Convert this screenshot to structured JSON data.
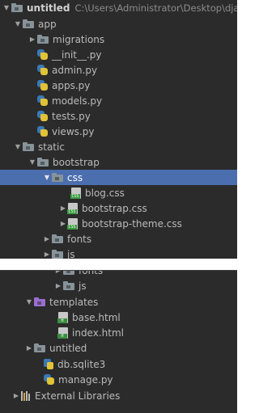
{
  "top_panel": {
    "rows": [
      {
        "label": "untitled",
        "path": "C:\\Users\\Administrator\\Desktop\\django"
      },
      {
        "label": "app"
      },
      {
        "label": "migrations"
      },
      {
        "label": "__init__.py"
      },
      {
        "label": "admin.py"
      },
      {
        "label": "apps.py"
      },
      {
        "label": "models.py"
      },
      {
        "label": "tests.py"
      },
      {
        "label": "views.py"
      },
      {
        "label": "static"
      },
      {
        "label": "bootstrap"
      },
      {
        "label": "css"
      },
      {
        "label": "blog.css"
      },
      {
        "label": "bootstrap.css"
      },
      {
        "label": "bootstrap-theme.css"
      },
      {
        "label": "fonts"
      },
      {
        "label": "js"
      }
    ]
  },
  "bottom_panel": {
    "rows": [
      {
        "label": "fonts"
      },
      {
        "label": "js"
      },
      {
        "label": "templates"
      },
      {
        "label": "base.html"
      },
      {
        "label": "index.html"
      },
      {
        "label": "untitled"
      },
      {
        "label": "db.sqlite3"
      },
      {
        "label": "manage.py"
      },
      {
        "label": "External Libraries"
      }
    ]
  },
  "icons": {
    "css_tag": "CSS",
    "html_tag": "H"
  },
  "colors": {
    "panel_bg": "#2b2b2b",
    "selection": "#4b6eaf",
    "folder": "#87939a",
    "templates_folder": "#9b6fd0"
  }
}
